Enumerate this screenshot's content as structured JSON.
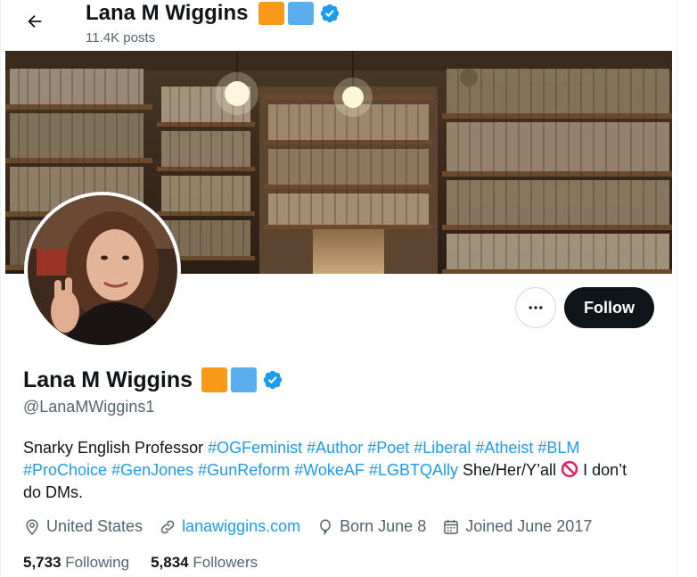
{
  "header": {
    "name": "Lana M Wiggins",
    "posts": "11.4K posts"
  },
  "badges": {
    "orange": "#f79a1a",
    "blue": "#5aaeee",
    "verified": "#1d9bf0"
  },
  "actions": {
    "follow_label": "Follow"
  },
  "profile": {
    "name": "Lana M Wiggins",
    "handle": "@LanaMWiggins1",
    "bio": {
      "intro": "Snarky English Professor",
      "tags": [
        "#OGFeminist",
        "#Author",
        "#Poet",
        "#Liberal",
        "#Atheist",
        "#BLM",
        "#ProChoice",
        "#GenJones",
        "#GunReform",
        "#WokeAF",
        "#LGBTQAlly"
      ],
      "pronouns": "She/Her/Y’all",
      "outro": "I don’t do DMs."
    },
    "location": "United States",
    "website": "lanawiggins.com",
    "birthday": "Born June 8",
    "joined": "Joined June 2017",
    "following_count": "5,733",
    "following_label": "Following",
    "followers_count": "5,834",
    "followers_label": "Followers"
  }
}
